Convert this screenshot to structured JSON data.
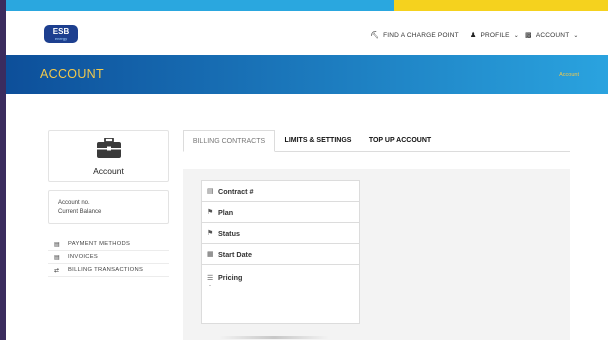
{
  "colors": {
    "stripe_left": "#2aa7df",
    "stripe_right": "#f5d21e",
    "banner_start": "#0d4f9a",
    "banner_end": "#2aa3df",
    "banner_text": "#f2c94c",
    "brand_blue": "#1d3f8f"
  },
  "logo": {
    "line1": "ESB",
    "line2": "energy"
  },
  "nav": {
    "charge_point": {
      "label": "FIND A CHARGE POINT",
      "icon": "plug-icon"
    },
    "profile": {
      "label": "PROFILE",
      "icon": "person-icon"
    },
    "account": {
      "label": "ACCOUNT",
      "icon": "briefcase-icon"
    }
  },
  "banner": {
    "title": "ACCOUNT",
    "breadcrumb": "Account"
  },
  "account_card": {
    "label": "Account",
    "icon": "briefcase-icon"
  },
  "balance_card": {
    "account_no": "Account no.",
    "current_balance": "Current Balance"
  },
  "side_menu": [
    {
      "label": "PAYMENT METHODS",
      "icon": "credit-card-icon"
    },
    {
      "label": "INVOICES",
      "icon": "invoice-icon"
    },
    {
      "label": "BILLING TRANSACTIONS",
      "icon": "exchange-icon"
    }
  ],
  "tabs": [
    {
      "label": "BILLING CONTRACTS",
      "active": true
    },
    {
      "label": "LIMITS & SETTINGS",
      "active": false
    },
    {
      "label": "TOP UP ACCOUNT",
      "active": false
    }
  ],
  "contract_table": {
    "rows": [
      {
        "label": "Contract #",
        "icon": "card-icon"
      },
      {
        "label": "Plan",
        "icon": "flag-icon"
      },
      {
        "label": "Status",
        "icon": "flag-icon"
      },
      {
        "label": "Start Date",
        "icon": "calendar-icon"
      },
      {
        "label": "Pricing",
        "icon": "coins-icon",
        "value": "-"
      }
    ]
  }
}
